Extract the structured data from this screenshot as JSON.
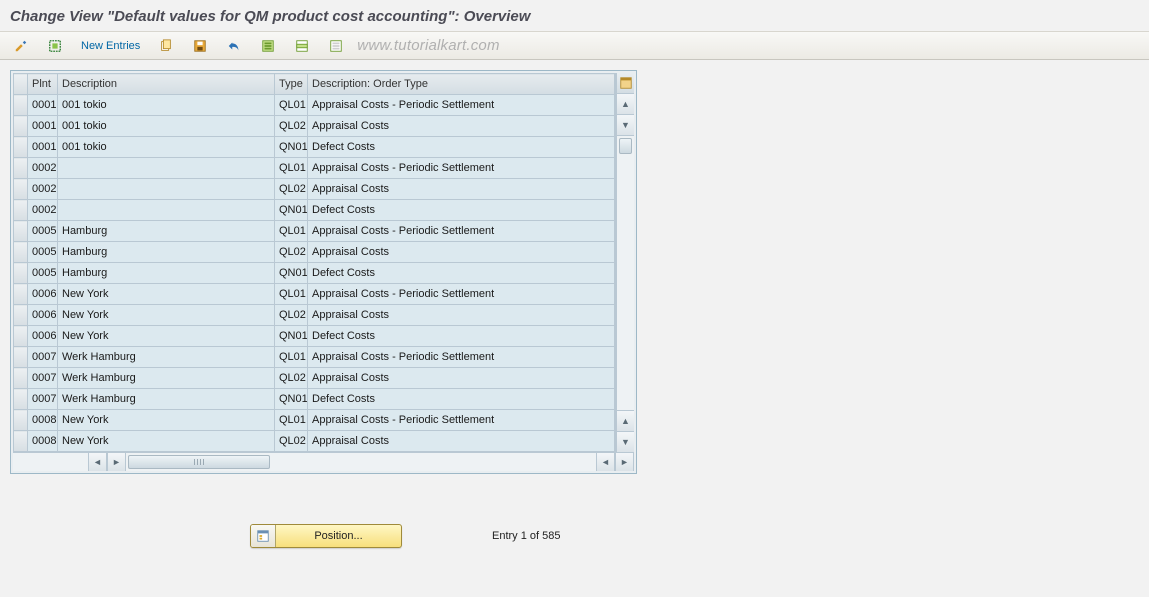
{
  "title": "Change View \"Default values for QM product cost accounting\": Overview",
  "toolbar": {
    "new_entries": "New Entries",
    "watermark": "www.tutorialkart.com"
  },
  "table": {
    "headers": {
      "plnt": "Plnt",
      "desc": "Description",
      "type": "Type",
      "odesc": "Description: Order Type"
    },
    "rows": [
      {
        "plnt": "0001",
        "desc": "001 tokio",
        "type": "QL01",
        "odesc": "Appraisal Costs - Periodic Settlement"
      },
      {
        "plnt": "0001",
        "desc": "001 tokio",
        "type": "QL02",
        "odesc": "Appraisal Costs"
      },
      {
        "plnt": "0001",
        "desc": "001 tokio",
        "type": "QN01",
        "odesc": "Defect Costs"
      },
      {
        "plnt": "0002",
        "desc": "",
        "type": "QL01",
        "odesc": "Appraisal Costs - Periodic Settlement"
      },
      {
        "plnt": "0002",
        "desc": "",
        "type": "QL02",
        "odesc": "Appraisal Costs"
      },
      {
        "plnt": "0002",
        "desc": "",
        "type": "QN01",
        "odesc": "Defect Costs"
      },
      {
        "plnt": "0005",
        "desc": "Hamburg",
        "type": "QL01",
        "odesc": "Appraisal Costs - Periodic Settlement"
      },
      {
        "plnt": "0005",
        "desc": "Hamburg",
        "type": "QL02",
        "odesc": "Appraisal Costs"
      },
      {
        "plnt": "0005",
        "desc": "Hamburg",
        "type": "QN01",
        "odesc": "Defect Costs"
      },
      {
        "plnt": "0006",
        "desc": "New York",
        "type": "QL01",
        "odesc": "Appraisal Costs - Periodic Settlement"
      },
      {
        "plnt": "0006",
        "desc": "New York",
        "type": "QL02",
        "odesc": "Appraisal Costs"
      },
      {
        "plnt": "0006",
        "desc": "New York",
        "type": "QN01",
        "odesc": "Defect Costs"
      },
      {
        "plnt": "0007",
        "desc": "Werk Hamburg",
        "type": "QL01",
        "odesc": "Appraisal Costs - Periodic Settlement"
      },
      {
        "plnt": "0007",
        "desc": "Werk Hamburg",
        "type": "QL02",
        "odesc": "Appraisal Costs"
      },
      {
        "plnt": "0007",
        "desc": "Werk Hamburg",
        "type": "QN01",
        "odesc": "Defect Costs"
      },
      {
        "plnt": "0008",
        "desc": "New York",
        "type": "QL01",
        "odesc": "Appraisal Costs - Periodic Settlement"
      },
      {
        "plnt": "0008",
        "desc": "New York",
        "type": "QL02",
        "odesc": "Appraisal Costs"
      }
    ]
  },
  "footer": {
    "position": "Position...",
    "entry": "Entry 1 of 585"
  },
  "icons": {
    "pencil_glasses": "toggle-display-change",
    "sel_contents": "select-contents",
    "copy": "copy",
    "save_var": "save-variant",
    "undo": "undo",
    "select_all": "select-all",
    "select_block": "select-block",
    "deselect_all": "deselect-all",
    "table_settings": "table-settings",
    "position": "position-icon"
  }
}
